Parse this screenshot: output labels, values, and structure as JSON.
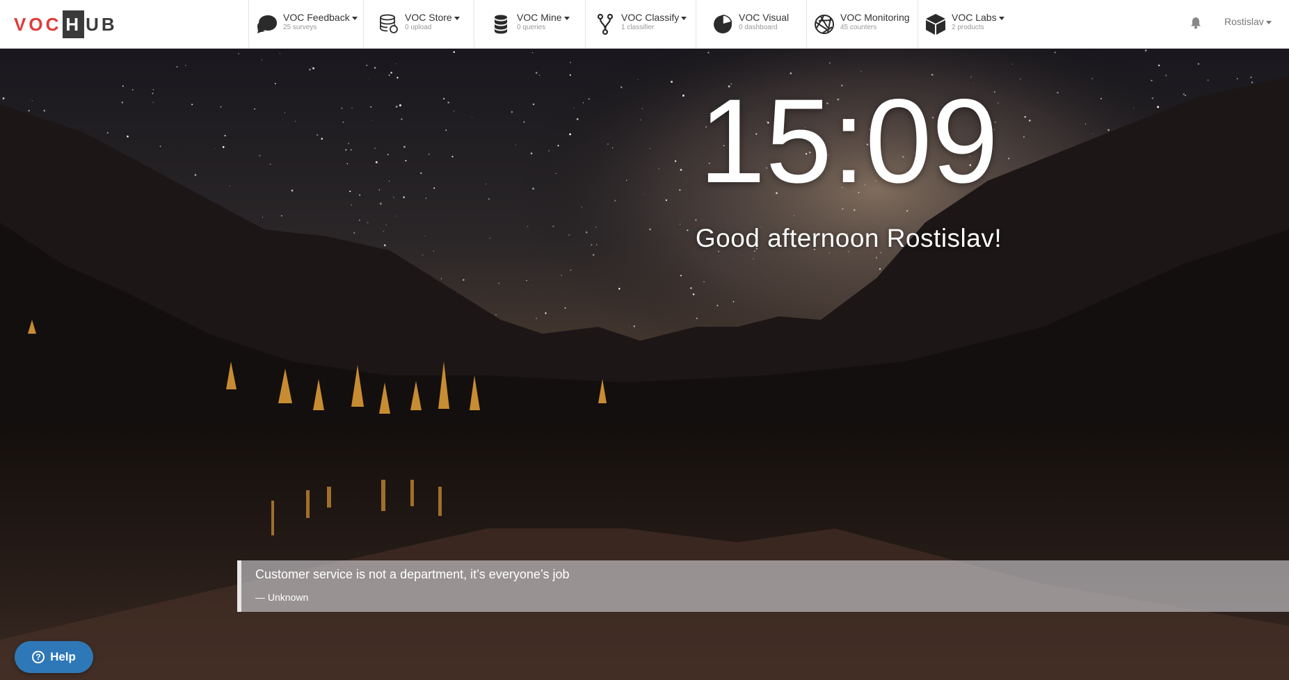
{
  "logo": {
    "voc": "VOC",
    "hub_boxed": "H",
    "hub_rest": "UB"
  },
  "nav": [
    {
      "label": "VOC Feedback",
      "sub": "25 surveys",
      "icon": "speech-bubbles-icon",
      "dropdown": true
    },
    {
      "label": "VOC Store",
      "sub": "0 upload",
      "icon": "database-refresh-icon",
      "dropdown": true
    },
    {
      "label": "VOC Mine",
      "sub": "0 queries",
      "icon": "database-icon",
      "dropdown": true
    },
    {
      "label": "VOC Classify",
      "sub": "1 classifier",
      "icon": "fork-branch-icon",
      "dropdown": true
    },
    {
      "label": "VOC Visual",
      "sub": "0 dashboard",
      "icon": "pie-chart-icon",
      "dropdown": false
    },
    {
      "label": "VOC Monitoring",
      "sub": "45 counters",
      "icon": "aperture-icon",
      "dropdown": false
    },
    {
      "label": "VOC Labs",
      "sub": "2 products",
      "icon": "cube-icon",
      "dropdown": true
    }
  ],
  "user": {
    "name": "Rostislav"
  },
  "clock": {
    "time": "15:09"
  },
  "greeting": "Good afternoon Rostislav!",
  "quote": {
    "text": "Customer service is not a department, it’s everyone’s job",
    "author": "— Unknown"
  },
  "help": {
    "label": "Help"
  },
  "colors": {
    "brand_red": "#e03a3a",
    "help_blue": "#2e78b8",
    "nav_bg": "#ffffff"
  }
}
